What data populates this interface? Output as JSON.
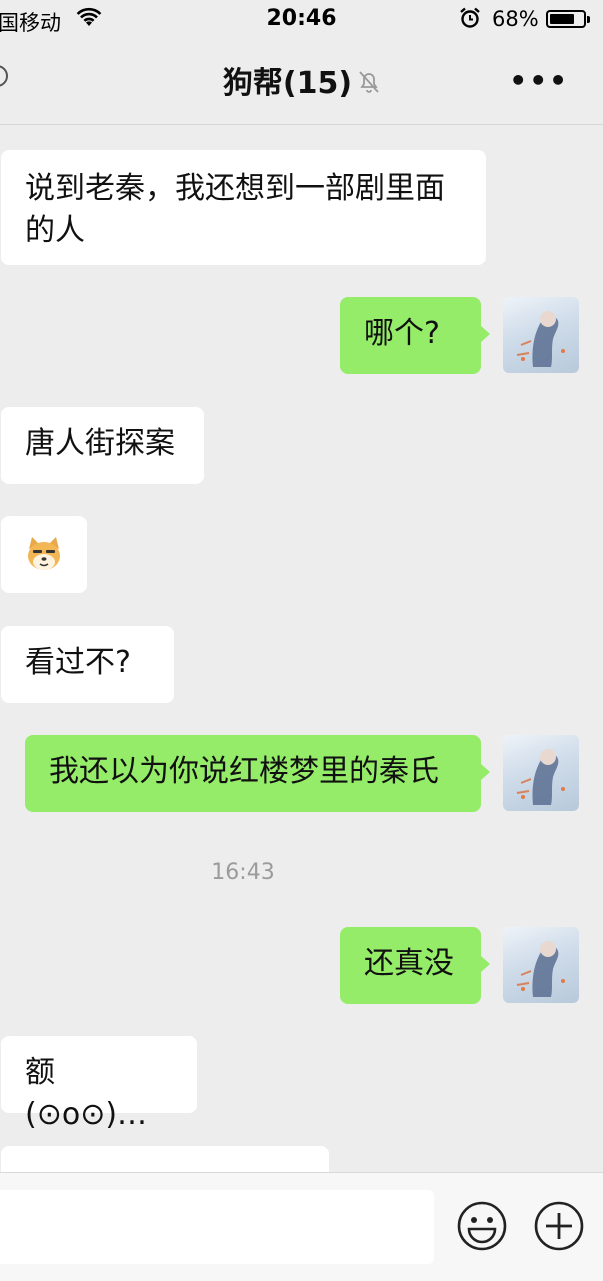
{
  "status_bar": {
    "carrier": "国移动",
    "time": "20:46",
    "battery": "68%",
    "battery_level": 0.68,
    "icons": [
      "wifi-icon",
      "alarm-icon",
      "battery-icon"
    ]
  },
  "header": {
    "title": "狗帮(15)",
    "icons": [
      "back-icon",
      "mute-bell-icon",
      "more-icon"
    ],
    "more_label": "•••"
  },
  "messages": [
    {
      "side": "left",
      "lines": [
        "说到老秦，我还想到一部剧里面",
        "的人"
      ]
    },
    {
      "side": "right",
      "text": "哪个?"
    },
    {
      "side": "left",
      "text": "唐人街探案"
    },
    {
      "side": "left",
      "sticker": "doge-emoji"
    },
    {
      "side": "left",
      "text": "看过不?"
    },
    {
      "side": "right",
      "text": "我还以为你说红楼梦里的秦氏"
    },
    {
      "side": "right",
      "text": "还真没"
    },
    {
      "side": "left",
      "text": "额(⊙o⊙)…"
    }
  ],
  "timestamp": "16:43",
  "input_bar": {
    "icons": [
      "emoji-icon",
      "plus-icon"
    ]
  },
  "colors": {
    "background": "#ededed",
    "sent_bubble": "#95ec69",
    "received_bubble": "#ffffff"
  }
}
